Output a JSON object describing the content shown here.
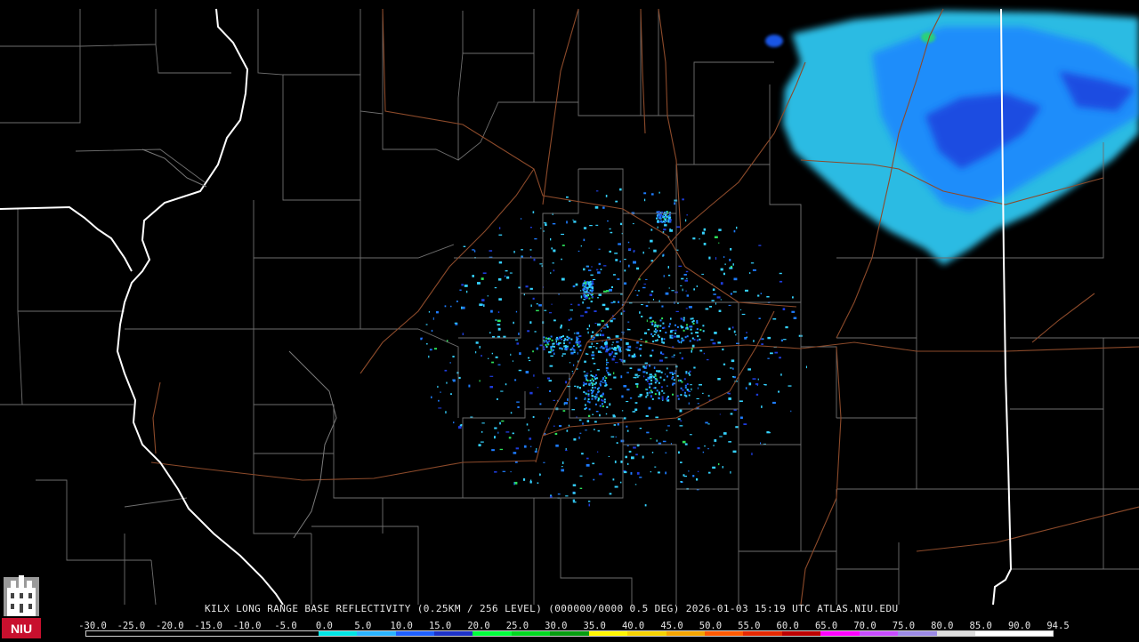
{
  "product": {
    "caption": "KILX LONG RANGE BASE REFLECTIVITY (0.25KM / 256 LEVEL) (000000/0000 0.5 DEG) 2026-01-03 15:19 UTC  ATLAS.NIU.EDU"
  },
  "logo": {
    "text": "NIU",
    "brand_color": "#c8102e"
  },
  "scale": {
    "labels": [
      "-30.0",
      "-25.0",
      "-20.0",
      "-15.0",
      "-10.0",
      "-5.0",
      "0.0",
      "5.0",
      "10.0",
      "15.0",
      "20.0",
      "25.0",
      "30.0",
      "35.0",
      "40.0",
      "45.0",
      "50.0",
      "55.0",
      "60.0",
      "65.0",
      "70.0",
      "75.0",
      "80.0",
      "85.0",
      "90.0",
      "94.5"
    ],
    "colors": [
      "#000000",
      "#000000",
      "#000000",
      "#000000",
      "#000000",
      "#000000",
      "#00e5e5",
      "#2ab4ff",
      "#1e60ff",
      "#1d32c8",
      "#00ff3c",
      "#00d820",
      "#069d10",
      "#fff600",
      "#f5d200",
      "#f5a500",
      "#ff5a00",
      "#e62800",
      "#bd0000",
      "#ff00ff",
      "#c84cff",
      "#9c8ae6",
      "#dddddd",
      "#ffffff",
      "#ffffff"
    ]
  },
  "colors": {
    "county_line": "#6e6e6e",
    "state_line": "#ffffff",
    "highway": "#8c4a2a",
    "echo_light": "#35d2ff",
    "echo_mid": "#1e7cff",
    "echo_dark": "#1e3cdc",
    "echo_green": "#2de05a"
  }
}
